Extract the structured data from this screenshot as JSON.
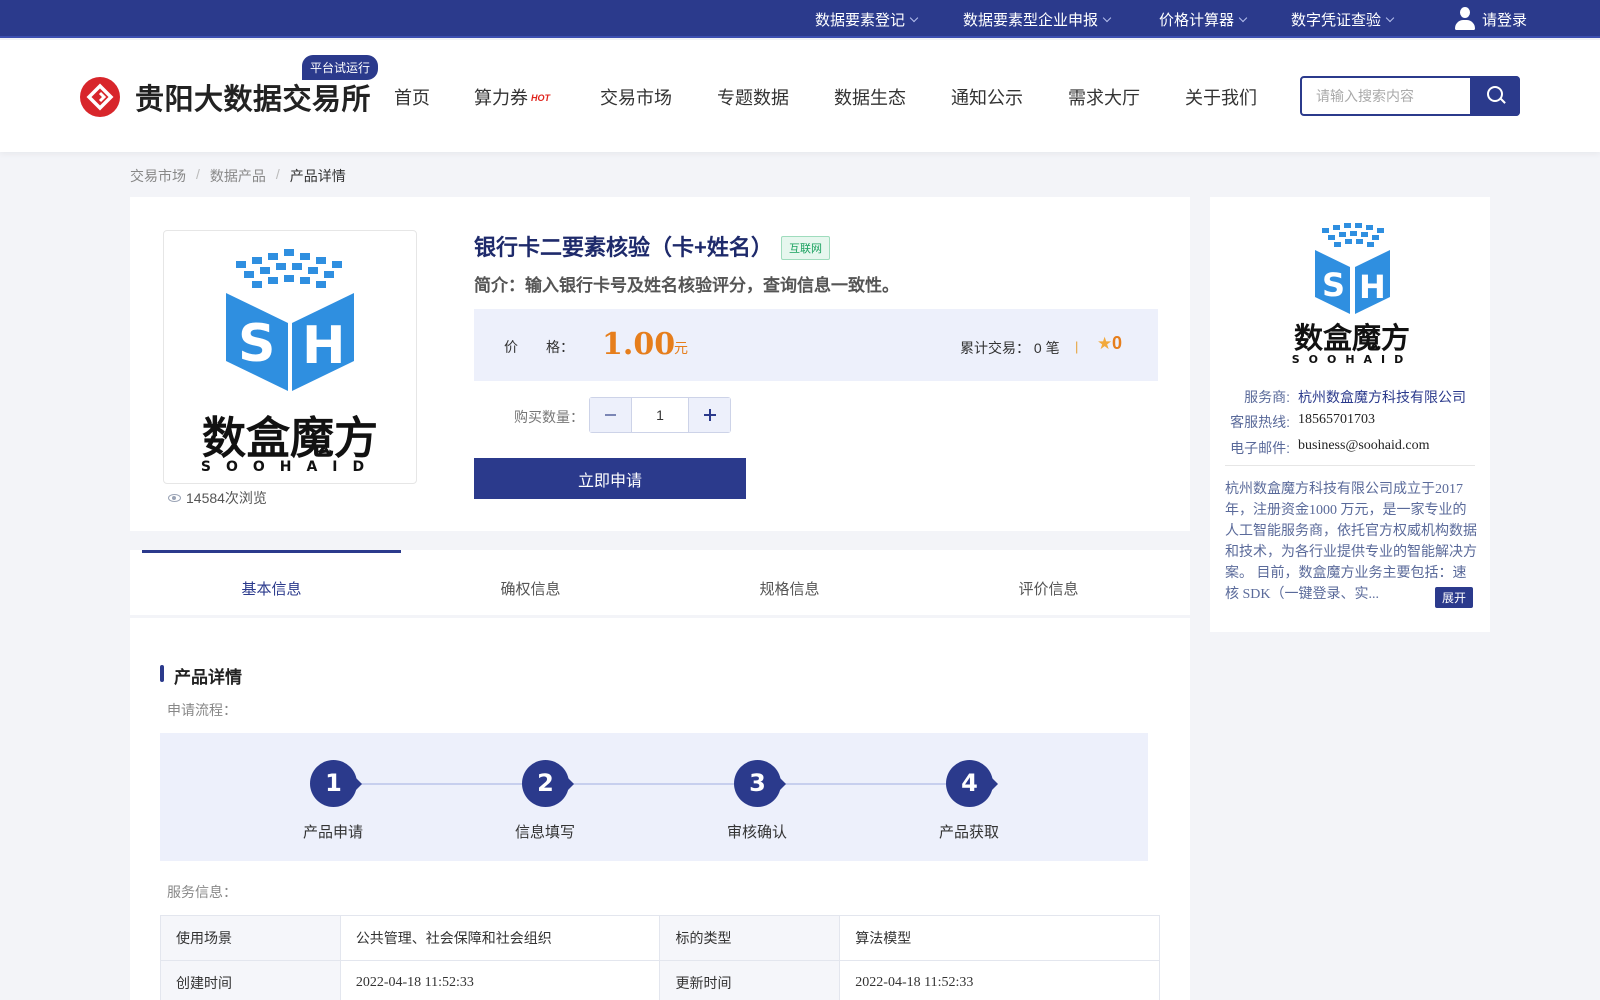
{
  "topbar": {
    "items": [
      {
        "label": "数据要素登记"
      },
      {
        "label": "数据要素型企业申报"
      },
      {
        "label": "价格计算器"
      },
      {
        "label": "数字凭证查验"
      }
    ],
    "login": "请登录"
  },
  "header": {
    "brand": "贵阳大数据交易所",
    "trial_badge": "平台试运行",
    "nav": [
      "首页",
      "算力券",
      "交易市场",
      "专题数据",
      "数据生态",
      "通知公示",
      "需求大厅",
      "关于我们"
    ],
    "hot_tag": "HOT",
    "search_placeholder": "请输入搜索内容"
  },
  "breadcrumb": [
    "交易市场",
    "数据产品",
    "产品详情"
  ],
  "breadcrumb_sep": "/",
  "product": {
    "logo_cn": "数盒魔方",
    "logo_en": "SOOHAID",
    "views": "14584次浏览",
    "title": "银行卡二要素核验（卡+姓名）",
    "tag": "互联网",
    "desc": "简介：输入银行卡号及姓名核验评分，查询信息一致性。",
    "price_label": "价　　格：",
    "price": "1.00",
    "price_unit": "元",
    "trade_count": "累计交易： 0 笔",
    "divider": "|",
    "rating": "0",
    "qty_label": "购买数量：",
    "qty_value": "1",
    "apply_button": "立即申请"
  },
  "tabs": [
    "基本信息",
    "确权信息",
    "规格信息",
    "评价信息"
  ],
  "active_tab": "基本信息",
  "details": {
    "section_title": "产品详情",
    "flow_label": "申请流程：",
    "steps": [
      {
        "num": "1",
        "label": "产品申请"
      },
      {
        "num": "2",
        "label": "信息填写"
      },
      {
        "num": "3",
        "label": "审核确认"
      },
      {
        "num": "4",
        "label": "产品获取"
      }
    ],
    "service_label": "服务信息：",
    "table": [
      [
        "使用场景",
        "公共管理、社会保障和社会组织",
        "标的类型",
        "算法模型"
      ],
      [
        "创建时间",
        "2022-04-18 11:52:33",
        "更新时间",
        "2022-04-18 11:52:33"
      ]
    ]
  },
  "provider": {
    "logo_cn": "数盒魔方",
    "logo_en": "SOOHAID",
    "name_label": "服务商:",
    "name": "杭州数盒魔方科技有限公司",
    "phone_label": "客服热线:",
    "phone": "18565701703",
    "email_label": "电子邮件:",
    "email": "business@soohaid.com",
    "intro": "杭州数盒魔方科技有限公司成立于2017年，注册资金1000 万元，是一家专业的人工智能服务商，依托官方权威机构数据和技术，为各行业提供专业的智能解决方案。 目前，数盒魔方业务主要包括：速核 SDK（一键登录、实...",
    "expand": "展开"
  },
  "colors": {
    "primary": "#2b3a8c",
    "accent_orange": "#e67e1c",
    "logo_red": "#d8262b",
    "logo_blue": "#2f8fe0"
  }
}
